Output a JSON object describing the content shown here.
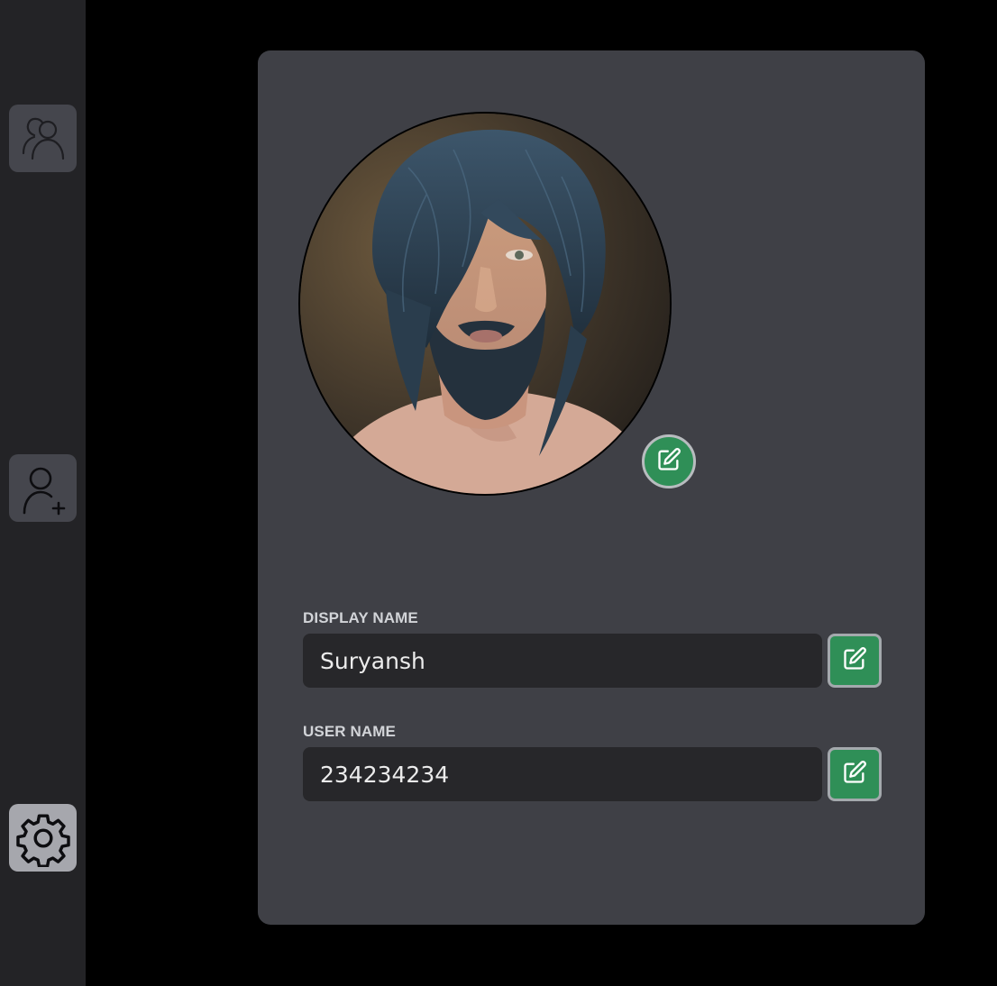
{
  "sidebar": {
    "items": [
      {
        "icon": "friends-icon",
        "active": false
      },
      {
        "icon": "add-user-icon",
        "active": false
      },
      {
        "icon": "gear-icon",
        "active": true
      }
    ]
  },
  "profile": {
    "avatar_icon": "profile-picture",
    "avatar_edit_icon": "pencil-square-icon",
    "display_name": {
      "label": "DISPLAY NAME",
      "value": "Suryansh",
      "edit_icon": "pencil-square-icon"
    },
    "user_name": {
      "label": "USER NAME",
      "value": "234234234",
      "edit_icon": "pencil-square-icon"
    }
  },
  "colors": {
    "sidebar_bg": "#232326",
    "card_bg": "#3f4046",
    "input_bg": "#27272a",
    "accent_green": "#2f8f57",
    "page_bg": "#000000"
  }
}
